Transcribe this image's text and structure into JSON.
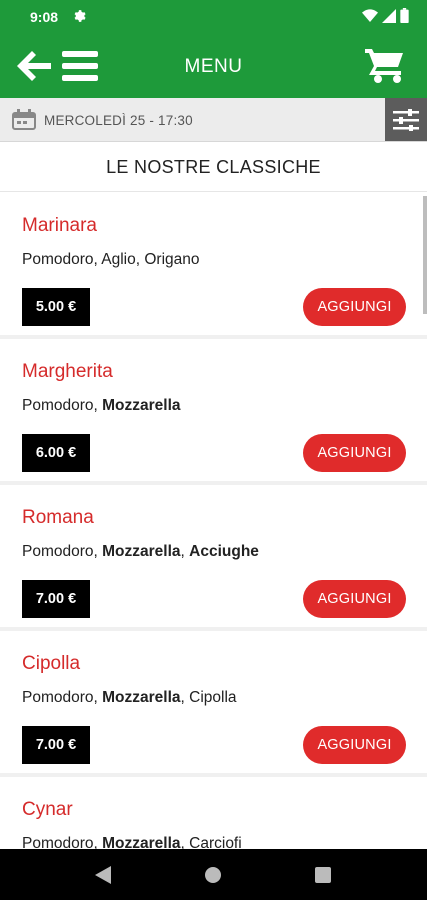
{
  "status": {
    "time": "9:08"
  },
  "header": {
    "title": "MENU"
  },
  "date_bar": {
    "text": "MERCOLEDÌ 25 - 17:30"
  },
  "section": {
    "title": "LE NOSTRE CLASSICHE"
  },
  "items": [
    {
      "name": "Marinara",
      "desc": [
        {
          "t": "Pomodoro, Aglio, Origano",
          "b": false
        }
      ],
      "price": "5.00 €",
      "add_label": "AGGIUNGI"
    },
    {
      "name": "Margherita",
      "desc": [
        {
          "t": "Pomodoro, ",
          "b": false
        },
        {
          "t": "Mozzarella",
          "b": true
        }
      ],
      "price": "6.00 €",
      "add_label": "AGGIUNGI"
    },
    {
      "name": "Romana",
      "desc": [
        {
          "t": "Pomodoro, ",
          "b": false
        },
        {
          "t": "Mozzarella",
          "b": true
        },
        {
          "t": ", ",
          "b": false
        },
        {
          "t": "Acciughe",
          "b": true
        }
      ],
      "price": "7.00 €",
      "add_label": "AGGIUNGI"
    },
    {
      "name": "Cipolla",
      "desc": [
        {
          "t": "Pomodoro, ",
          "b": false
        },
        {
          "t": "Mozzarella",
          "b": true
        },
        {
          "t": ", Cipolla",
          "b": false
        }
      ],
      "price": "7.00 €",
      "add_label": "AGGIUNGI"
    },
    {
      "name": "Cynar",
      "desc": [
        {
          "t": "Pomodoro, ",
          "b": false
        },
        {
          "t": "Mozzarella",
          "b": true
        },
        {
          "t": ", Carciofi",
          "b": false
        }
      ],
      "price": "",
      "add_label": ""
    }
  ],
  "colors": {
    "header": "#1e9a3a",
    "accent": "#e02b2b",
    "item_name": "#d52b2b",
    "price_bg": "#000000"
  },
  "icons": [
    "settings-icon",
    "wifi-icon",
    "signal-icon",
    "battery-icon",
    "back-arrow-icon",
    "menu-icon",
    "cart-icon",
    "calendar-icon",
    "filter-icon",
    "nav-back-icon",
    "nav-home-icon",
    "nav-recents-icon"
  ]
}
